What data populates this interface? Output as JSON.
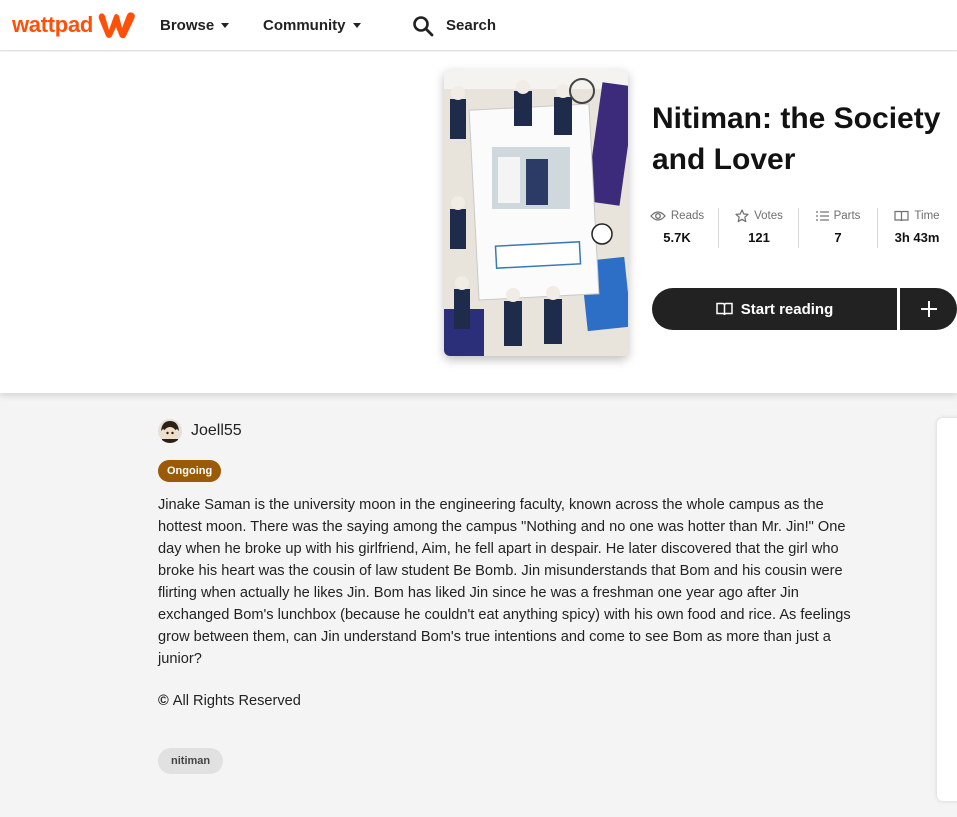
{
  "nav": {
    "logo_text": "wattpad",
    "browse_label": "Browse",
    "community_label": "Community",
    "search_label": "Search"
  },
  "story": {
    "title": "Nitiman: the Society and Lover",
    "stats": [
      {
        "label": "Reads",
        "value": "5.7K",
        "icon": "eye-icon"
      },
      {
        "label": "Votes",
        "value": "121",
        "icon": "star-icon"
      },
      {
        "label": "Parts",
        "value": "7",
        "icon": "list-icon"
      },
      {
        "label": "Time",
        "value": "3h 43m",
        "icon": "book-icon"
      }
    ],
    "start_reading_label": "Start reading",
    "author": "Joell55",
    "status": "Ongoing",
    "description": "Jinake Saman is the university moon in the engineering faculty, known across the whole campus as the hottest moon. There was the saying among the campus \"Nothing and no one was hotter than Mr. Jin!\" One day when he broke up with his girlfriend, Aim, he fell apart in despair. He later discovered that the girl who broke his heart was the cousin of law student Be Bomb. Jin misunderstands that Bom and his cousin were flirting when actually he likes Jin. Bom has liked Jin since he was a freshman one year ago after Jin exchanged Bom's lunchbox (because he couldn't eat anything spicy) with his own food and rice. As feelings grow between them, can Jin understand Bom's true intentions and come to see Bom as more than just a junior?",
    "copyright_icon": "©",
    "copyright": "All Rights Reserved",
    "tags": [
      "nitiman"
    ]
  },
  "colors": {
    "brand": "#ff500a",
    "badge": "#9b5a05",
    "button": "#222222"
  }
}
